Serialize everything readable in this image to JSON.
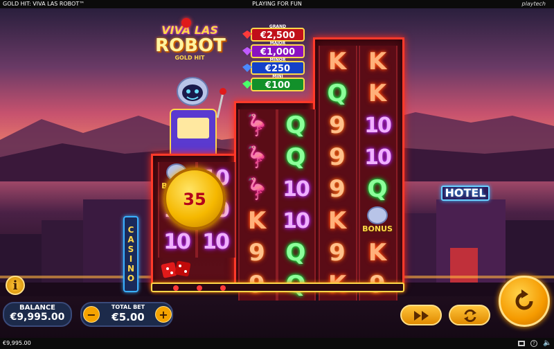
{
  "topbar": {
    "game_title": "GOLD HIT: VIVA LAS ROBOT™",
    "mode": "PLAYING FOR FUN",
    "brand": "playtech"
  },
  "logo": {
    "line1": "VIVA LAS",
    "line2": "ROBOT",
    "line3": "GOLD HIT"
  },
  "jackpots": [
    {
      "label": "GRAND",
      "value": "€2,500",
      "color": "#e01a1a"
    },
    {
      "label": "MAJOR",
      "value": "€1,000",
      "color": "#9a1ad0"
    },
    {
      "label": "MINOR",
      "value": "€250",
      "color": "#1a4ae0"
    },
    {
      "label": "MINI",
      "value": "€100",
      "color": "#1aa030"
    }
  ],
  "reels": [
    [
      "bonus",
      "10",
      "10"
    ],
    [
      "10",
      "10",
      "10"
    ],
    [
      "flamingo",
      "flamingo",
      "flamingo",
      "K",
      "9",
      "9"
    ],
    [
      "Q",
      "Q",
      "10",
      "10",
      "Q",
      "Q"
    ],
    [
      "K",
      "Q",
      "9",
      "9",
      "9",
      "K",
      "9",
      "K"
    ],
    [
      "K",
      "K",
      "10",
      "10",
      "Q",
      "bonus",
      "K",
      "9"
    ]
  ],
  "coin": {
    "value": "35"
  },
  "bonus_label": "BONUS",
  "city": {
    "hotel_sign": "HOTEL",
    "casino_sign": "CASINO"
  },
  "balance": {
    "label": "BALANCE",
    "value": "€9,995.00"
  },
  "bet": {
    "label": "TOTAL BET",
    "value": "€5.00",
    "minus": "−",
    "plus": "+"
  },
  "info": {
    "label": "i"
  },
  "controls": {
    "spin_icon": "spin-icon",
    "turbo_icon": "fast-forward-icon",
    "autoplay_icon": "autoplay-icon"
  },
  "footer": {
    "balance": "€9,995.00"
  },
  "colors": {
    "reel_frame": "#ff3a2a",
    "button_gold": "#f5a300",
    "panel": "#1c2a4a"
  }
}
